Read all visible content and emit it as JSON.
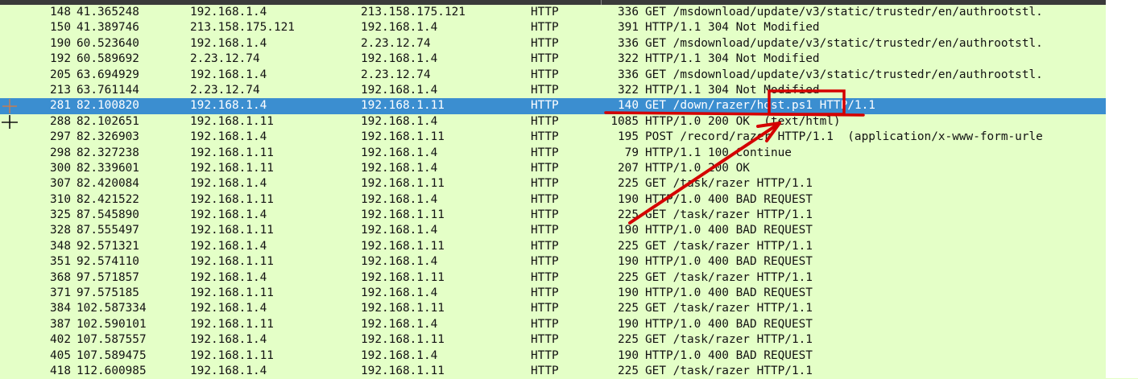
{
  "colors": {
    "row_background": "#e4ffc7",
    "selected_background": "#3b8ed0",
    "annotation": "#d40000"
  },
  "packets": [
    {
      "no": "148",
      "time": "41.365248",
      "src": "192.168.1.4",
      "dst": "213.158.175.121",
      "proto": "HTTP",
      "len": "336",
      "info": "GET /msdownload/update/v3/static/trustedr/en/authrootstl."
    },
    {
      "no": "150",
      "time": "41.389746",
      "src": "213.158.175.121",
      "dst": "192.168.1.4",
      "proto": "HTTP",
      "len": "391",
      "info": "HTTP/1.1 304 Not Modified"
    },
    {
      "no": "190",
      "time": "60.523640",
      "src": "192.168.1.4",
      "dst": "2.23.12.74",
      "proto": "HTTP",
      "len": "336",
      "info": "GET /msdownload/update/v3/static/trustedr/en/authrootstl."
    },
    {
      "no": "192",
      "time": "60.589692",
      "src": "2.23.12.74",
      "dst": "192.168.1.4",
      "proto": "HTTP",
      "len": "322",
      "info": "HTTP/1.1 304 Not Modified"
    },
    {
      "no": "205",
      "time": "63.694929",
      "src": "192.168.1.4",
      "dst": "2.23.12.74",
      "proto": "HTTP",
      "len": "336",
      "info": "GET /msdownload/update/v3/static/trustedr/en/authrootstl."
    },
    {
      "no": "213",
      "time": "63.761144",
      "src": "2.23.12.74",
      "dst": "192.168.1.4",
      "proto": "HTTP",
      "len": "322",
      "info": "HTTP/1.1 304 Not Modified"
    },
    {
      "no": "281",
      "time": "82.100820",
      "src": "192.168.1.4",
      "dst": "192.168.1.11",
      "proto": "HTTP",
      "len": "140",
      "info": "GET /down/razer/host.ps1 HTTP/1.1",
      "selected": true
    },
    {
      "no": "288",
      "time": "82.102651",
      "src": "192.168.1.11",
      "dst": "192.168.1.4",
      "proto": "HTTP",
      "len": "1085",
      "info": "HTTP/1.0 200 OK  (text/html)"
    },
    {
      "no": "297",
      "time": "82.326903",
      "src": "192.168.1.4",
      "dst": "192.168.1.11",
      "proto": "HTTP",
      "len": "195",
      "info": "POST /record/razer HTTP/1.1  (application/x-www-form-urle"
    },
    {
      "no": "298",
      "time": "82.327238",
      "src": "192.168.1.11",
      "dst": "192.168.1.4",
      "proto": "HTTP",
      "len": "79",
      "info": "HTTP/1.1 100 Continue"
    },
    {
      "no": "300",
      "time": "82.339601",
      "src": "192.168.1.11",
      "dst": "192.168.1.4",
      "proto": "HTTP",
      "len": "207",
      "info": "HTTP/1.0 200 OK"
    },
    {
      "no": "307",
      "time": "82.420084",
      "src": "192.168.1.4",
      "dst": "192.168.1.11",
      "proto": "HTTP",
      "len": "225",
      "info": "GET /task/razer HTTP/1.1"
    },
    {
      "no": "310",
      "time": "82.421522",
      "src": "192.168.1.11",
      "dst": "192.168.1.4",
      "proto": "HTTP",
      "len": "190",
      "info": "HTTP/1.0 400 BAD REQUEST"
    },
    {
      "no": "325",
      "time": "87.545890",
      "src": "192.168.1.4",
      "dst": "192.168.1.11",
      "proto": "HTTP",
      "len": "225",
      "info": "GET /task/razer HTTP/1.1"
    },
    {
      "no": "328",
      "time": "87.555497",
      "src": "192.168.1.11",
      "dst": "192.168.1.4",
      "proto": "HTTP",
      "len": "190",
      "info": "HTTP/1.0 400 BAD REQUEST"
    },
    {
      "no": "348",
      "time": "92.571321",
      "src": "192.168.1.4",
      "dst": "192.168.1.11",
      "proto": "HTTP",
      "len": "225",
      "info": "GET /task/razer HTTP/1.1"
    },
    {
      "no": "351",
      "time": "92.574110",
      "src": "192.168.1.11",
      "dst": "192.168.1.4",
      "proto": "HTTP",
      "len": "190",
      "info": "HTTP/1.0 400 BAD REQUEST"
    },
    {
      "no": "368",
      "time": "97.571857",
      "src": "192.168.1.4",
      "dst": "192.168.1.11",
      "proto": "HTTP",
      "len": "225",
      "info": "GET /task/razer HTTP/1.1"
    },
    {
      "no": "371",
      "time": "97.575185",
      "src": "192.168.1.11",
      "dst": "192.168.1.4",
      "proto": "HTTP",
      "len": "190",
      "info": "HTTP/1.0 400 BAD REQUEST"
    },
    {
      "no": "384",
      "time": "102.587334",
      "src": "192.168.1.4",
      "dst": "192.168.1.11",
      "proto": "HTTP",
      "len": "225",
      "info": "GET /task/razer HTTP/1.1"
    },
    {
      "no": "387",
      "time": "102.590101",
      "src": "192.168.1.11",
      "dst": "192.168.1.4",
      "proto": "HTTP",
      "len": "190",
      "info": "HTTP/1.0 400 BAD REQUEST"
    },
    {
      "no": "402",
      "time": "107.587557",
      "src": "192.168.1.4",
      "dst": "192.168.1.11",
      "proto": "HTTP",
      "len": "225",
      "info": "GET /task/razer HTTP/1.1"
    },
    {
      "no": "405",
      "time": "107.589475",
      "src": "192.168.1.11",
      "dst": "192.168.1.4",
      "proto": "HTTP",
      "len": "190",
      "info": "HTTP/1.0 400 BAD REQUEST"
    },
    {
      "no": "418",
      "time": "112.600985",
      "src": "192.168.1.4",
      "dst": "192.168.1.11",
      "proto": "HTTP",
      "len": "225",
      "info": "GET /task/razer HTTP/1.1"
    }
  ]
}
